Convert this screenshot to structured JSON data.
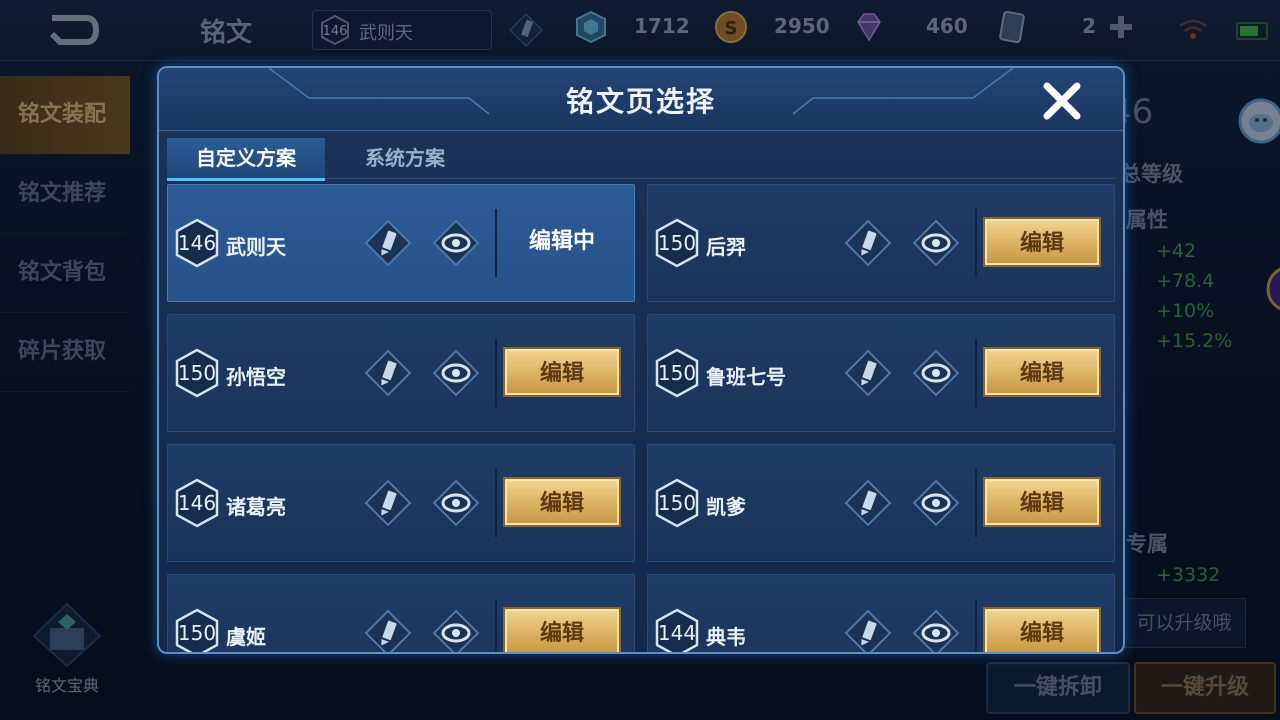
{
  "top_bar": {
    "title": "铭文",
    "hero": {
      "level": "146",
      "name": "武则天"
    },
    "resources": [
      {
        "icon": "crystal-icon",
        "value": "1712"
      },
      {
        "icon": "gold-coin-icon",
        "value": "2950"
      },
      {
        "icon": "gem-icon",
        "value": "460"
      },
      {
        "icon": "card-icon",
        "value": "2"
      }
    ]
  },
  "sidebar": {
    "items": [
      {
        "label": "铭文装配",
        "active": true
      },
      {
        "label": "铭文推荐",
        "active": false
      },
      {
        "label": "铭文背包",
        "active": false
      },
      {
        "label": "碎片获取",
        "active": false
      }
    ],
    "codex_label": "铭文宝典"
  },
  "background_panel": {
    "level_value": "46",
    "level_label": "总等级",
    "attr_header": "属性",
    "attrs": [
      "+42",
      "+78.4",
      "+10%",
      "+15.2%"
    ],
    "exclusive_label": "专属",
    "exclusive_value": "+3332",
    "upgrade_hint": "可以升级哦",
    "btn_unload": "一键拆卸",
    "btn_upgrade": "一键升级"
  },
  "modal": {
    "title": "铭文页选择",
    "tabs": [
      {
        "label": "自定义方案",
        "active": true
      },
      {
        "label": "系统方案",
        "active": false
      }
    ],
    "edit_label": "编辑",
    "editing_label": "编辑中",
    "pages": [
      {
        "level": "146",
        "hero": "武则天",
        "current": true
      },
      {
        "level": "150",
        "hero": "后羿",
        "current": false
      },
      {
        "level": "150",
        "hero": "孙悟空",
        "current": false
      },
      {
        "level": "150",
        "hero": "鲁班七号",
        "current": false
      },
      {
        "level": "146",
        "hero": "诸葛亮",
        "current": false
      },
      {
        "level": "150",
        "hero": "凯爹",
        "current": false
      },
      {
        "level": "150",
        "hero": "虞姬",
        "current": false
      },
      {
        "level": "144",
        "hero": "典韦",
        "current": false
      }
    ]
  },
  "colors": {
    "accent_gold": "#d9ad5d",
    "modal_border": "#5b8fc6",
    "attr_green": "#4cae57"
  }
}
